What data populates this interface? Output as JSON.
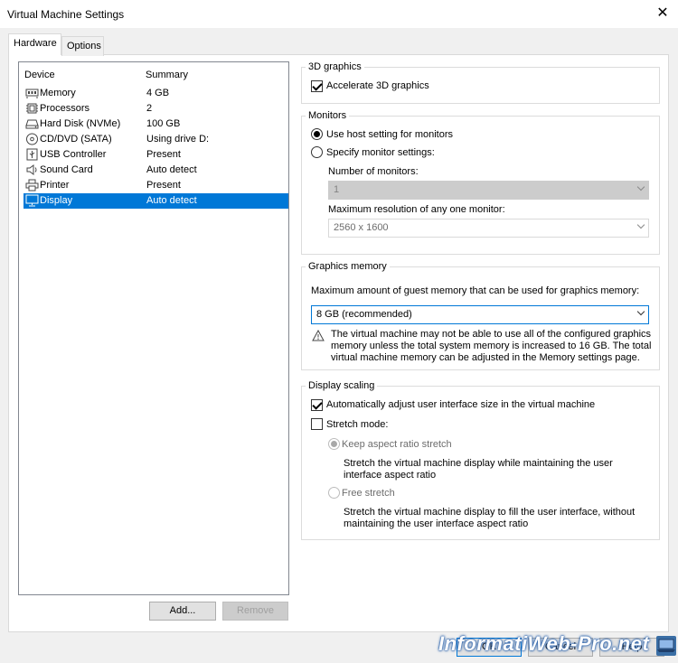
{
  "window": {
    "title": "Virtual Machine Settings",
    "close_glyph": "✕"
  },
  "tabs": [
    {
      "label": "Hardware"
    },
    {
      "label": "Options"
    }
  ],
  "device_list": {
    "col_device": "Device",
    "col_summary": "Summary",
    "rows": [
      {
        "name": "Memory",
        "summary": "4 GB",
        "icon": "memory-icon"
      },
      {
        "name": "Processors",
        "summary": "2",
        "icon": "processor-icon"
      },
      {
        "name": "Hard Disk (NVMe)",
        "summary": "100 GB",
        "icon": "hard-disk-icon"
      },
      {
        "name": "CD/DVD (SATA)",
        "summary": "Using drive D:",
        "icon": "cd-dvd-icon"
      },
      {
        "name": "USB Controller",
        "summary": "Present",
        "icon": "usb-icon"
      },
      {
        "name": "Sound Card",
        "summary": "Auto detect",
        "icon": "speaker-icon"
      },
      {
        "name": "Printer",
        "summary": "Present",
        "icon": "printer-icon"
      },
      {
        "name": "Display",
        "summary": "Auto detect",
        "icon": "monitor-icon",
        "selected": true
      }
    ],
    "add_label": "Add...",
    "remove_label": "Remove"
  },
  "graphics3d": {
    "legend": "3D graphics",
    "accelerate_label": "Accelerate 3D graphics",
    "accelerate_checked": true
  },
  "monitors": {
    "legend": "Monitors",
    "use_host_label": "Use host setting for monitors",
    "specify_label": "Specify monitor settings:",
    "selected": "use_host",
    "num_monitors_label": "Number of monitors:",
    "num_monitors_value": "1",
    "max_res_label": "Maximum resolution of any one monitor:",
    "max_res_value": "2560 x 1600"
  },
  "graphics_memory": {
    "legend": "Graphics memory",
    "desc": "Maximum amount of guest memory that can be used for graphics memory:",
    "value": "8 GB (recommended)",
    "warning_line1": "The virtual machine may not be able to use all of the configured graphics",
    "warning_line2": "memory unless the total system memory is increased to 16 GB. The total",
    "warning_line3": "virtual machine memory can be adjusted in the Memory settings page."
  },
  "display_scaling": {
    "legend": "Display scaling",
    "auto_adjust_label": "Automatically adjust user interface size in the virtual machine",
    "auto_adjust_checked": true,
    "stretch_mode_label": "Stretch mode:",
    "stretch_mode_checked": false,
    "keep_aspect_label": "Keep aspect ratio stretch",
    "keep_aspect_desc1": "Stretch the virtual machine display while maintaining the user",
    "keep_aspect_desc2": "interface aspect ratio",
    "free_stretch_label": "Free stretch",
    "free_stretch_desc1": "Stretch the virtual machine display to fill the user interface, without",
    "free_stretch_desc2": "maintaining the user interface aspect ratio"
  },
  "footer": {
    "ok_label": "OK",
    "cancel_label": "Cancel",
    "help_label": "Help"
  },
  "watermark": {
    "text": "InformatiWeb-Pro.net"
  },
  "colors": {
    "selection": "#0078d7",
    "window_bg": "#f0f0f0"
  }
}
